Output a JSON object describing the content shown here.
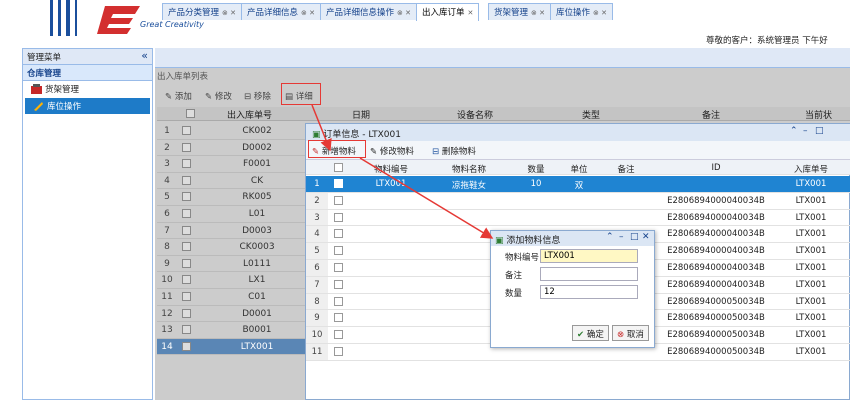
{
  "header": {
    "logo_text": "Great Creativity",
    "welcome": "尊敬的客户：系统管理员 下午好"
  },
  "sidebar": {
    "title": "管理菜单",
    "collapse_icon": "«",
    "group": "仓库管理",
    "items": [
      {
        "label": "货架管理",
        "icon": "shelf-icon"
      },
      {
        "label": "库位操作",
        "icon": "location-icon",
        "selected": true
      }
    ]
  },
  "tabs": [
    {
      "label": "产品分类管理"
    },
    {
      "label": "产品详细信息"
    },
    {
      "label": "产品详细信息操作"
    },
    {
      "label": "出入库订单",
      "active": true
    },
    {
      "label": "货架管理"
    },
    {
      "label": "库位操作"
    }
  ],
  "main": {
    "title": "出入库单列表",
    "toolbar": {
      "add": "添加",
      "edit": "修改",
      "remove": "移除",
      "detail": "详细"
    },
    "columns": [
      "出入库单号",
      "日期",
      "设备名称",
      "类型",
      "备注",
      "当前状"
    ],
    "rows": [
      {
        "n": "1",
        "code": "CK002"
      },
      {
        "n": "2",
        "code": "D0002"
      },
      {
        "n": "3",
        "code": "F0001"
      },
      {
        "n": "4",
        "code": "CK"
      },
      {
        "n": "5",
        "code": "RK005"
      },
      {
        "n": "6",
        "code": "L01"
      },
      {
        "n": "7",
        "code": "D0003"
      },
      {
        "n": "8",
        "code": "CK0003"
      },
      {
        "n": "9",
        "code": "L0111"
      },
      {
        "n": "10",
        "code": "LX1"
      },
      {
        "n": "11",
        "code": "C01"
      },
      {
        "n": "12",
        "code": "D0001"
      },
      {
        "n": "13",
        "code": "B0001"
      },
      {
        "n": "14",
        "code": "LTX001",
        "selected": true
      }
    ]
  },
  "order_window": {
    "title": "订单信息 - LTX001",
    "toolbar": {
      "add": "新增物料",
      "edit": "修改物料",
      "delete": "删除物料"
    },
    "columns": [
      "物料编号",
      "物料名称",
      "数量",
      "单位",
      "备注",
      "ID",
      "入库单号"
    ],
    "rows": [
      {
        "n": "1",
        "code": "LTX001",
        "name": "凉拖鞋女",
        "qty": "10",
        "unit": "双",
        "id": "",
        "order": "LTX001",
        "selected": true
      },
      {
        "n": "2",
        "id": "E2806894000040034B",
        "order": "LTX001"
      },
      {
        "n": "3",
        "id": "E2806894000040034B",
        "order": "LTX001"
      },
      {
        "n": "4",
        "id": "E2806894000040034B",
        "order": "LTX001"
      },
      {
        "n": "5",
        "id": "E2806894000040034B",
        "order": "LTX001"
      },
      {
        "n": "6",
        "id": "E2806894000040034B",
        "order": "LTX001"
      },
      {
        "n": "7",
        "id": "E2806894000040034B",
        "order": "LTX001"
      },
      {
        "n": "8",
        "id": "E2806894000050034B",
        "order": "LTX001"
      },
      {
        "n": "9",
        "id": "E2806894000050034B",
        "order": "LTX001"
      },
      {
        "n": "10",
        "id": "E2806894000050034B",
        "order": "LTX001"
      },
      {
        "n": "11",
        "id": "E2806894000050034B",
        "order": "LTX001"
      }
    ]
  },
  "add_window": {
    "title": "添加物料信息",
    "fields": {
      "code_label": "物料编号",
      "code_value": "LTX001",
      "note_label": "备注",
      "note_value": "",
      "qty_label": "数量",
      "qty_value": "12"
    },
    "ok": "确定",
    "cancel": "取消"
  },
  "colors": {
    "accent": "#1f84d2",
    "highlight": "#e53935",
    "header_bg": "#dfe8f6"
  }
}
